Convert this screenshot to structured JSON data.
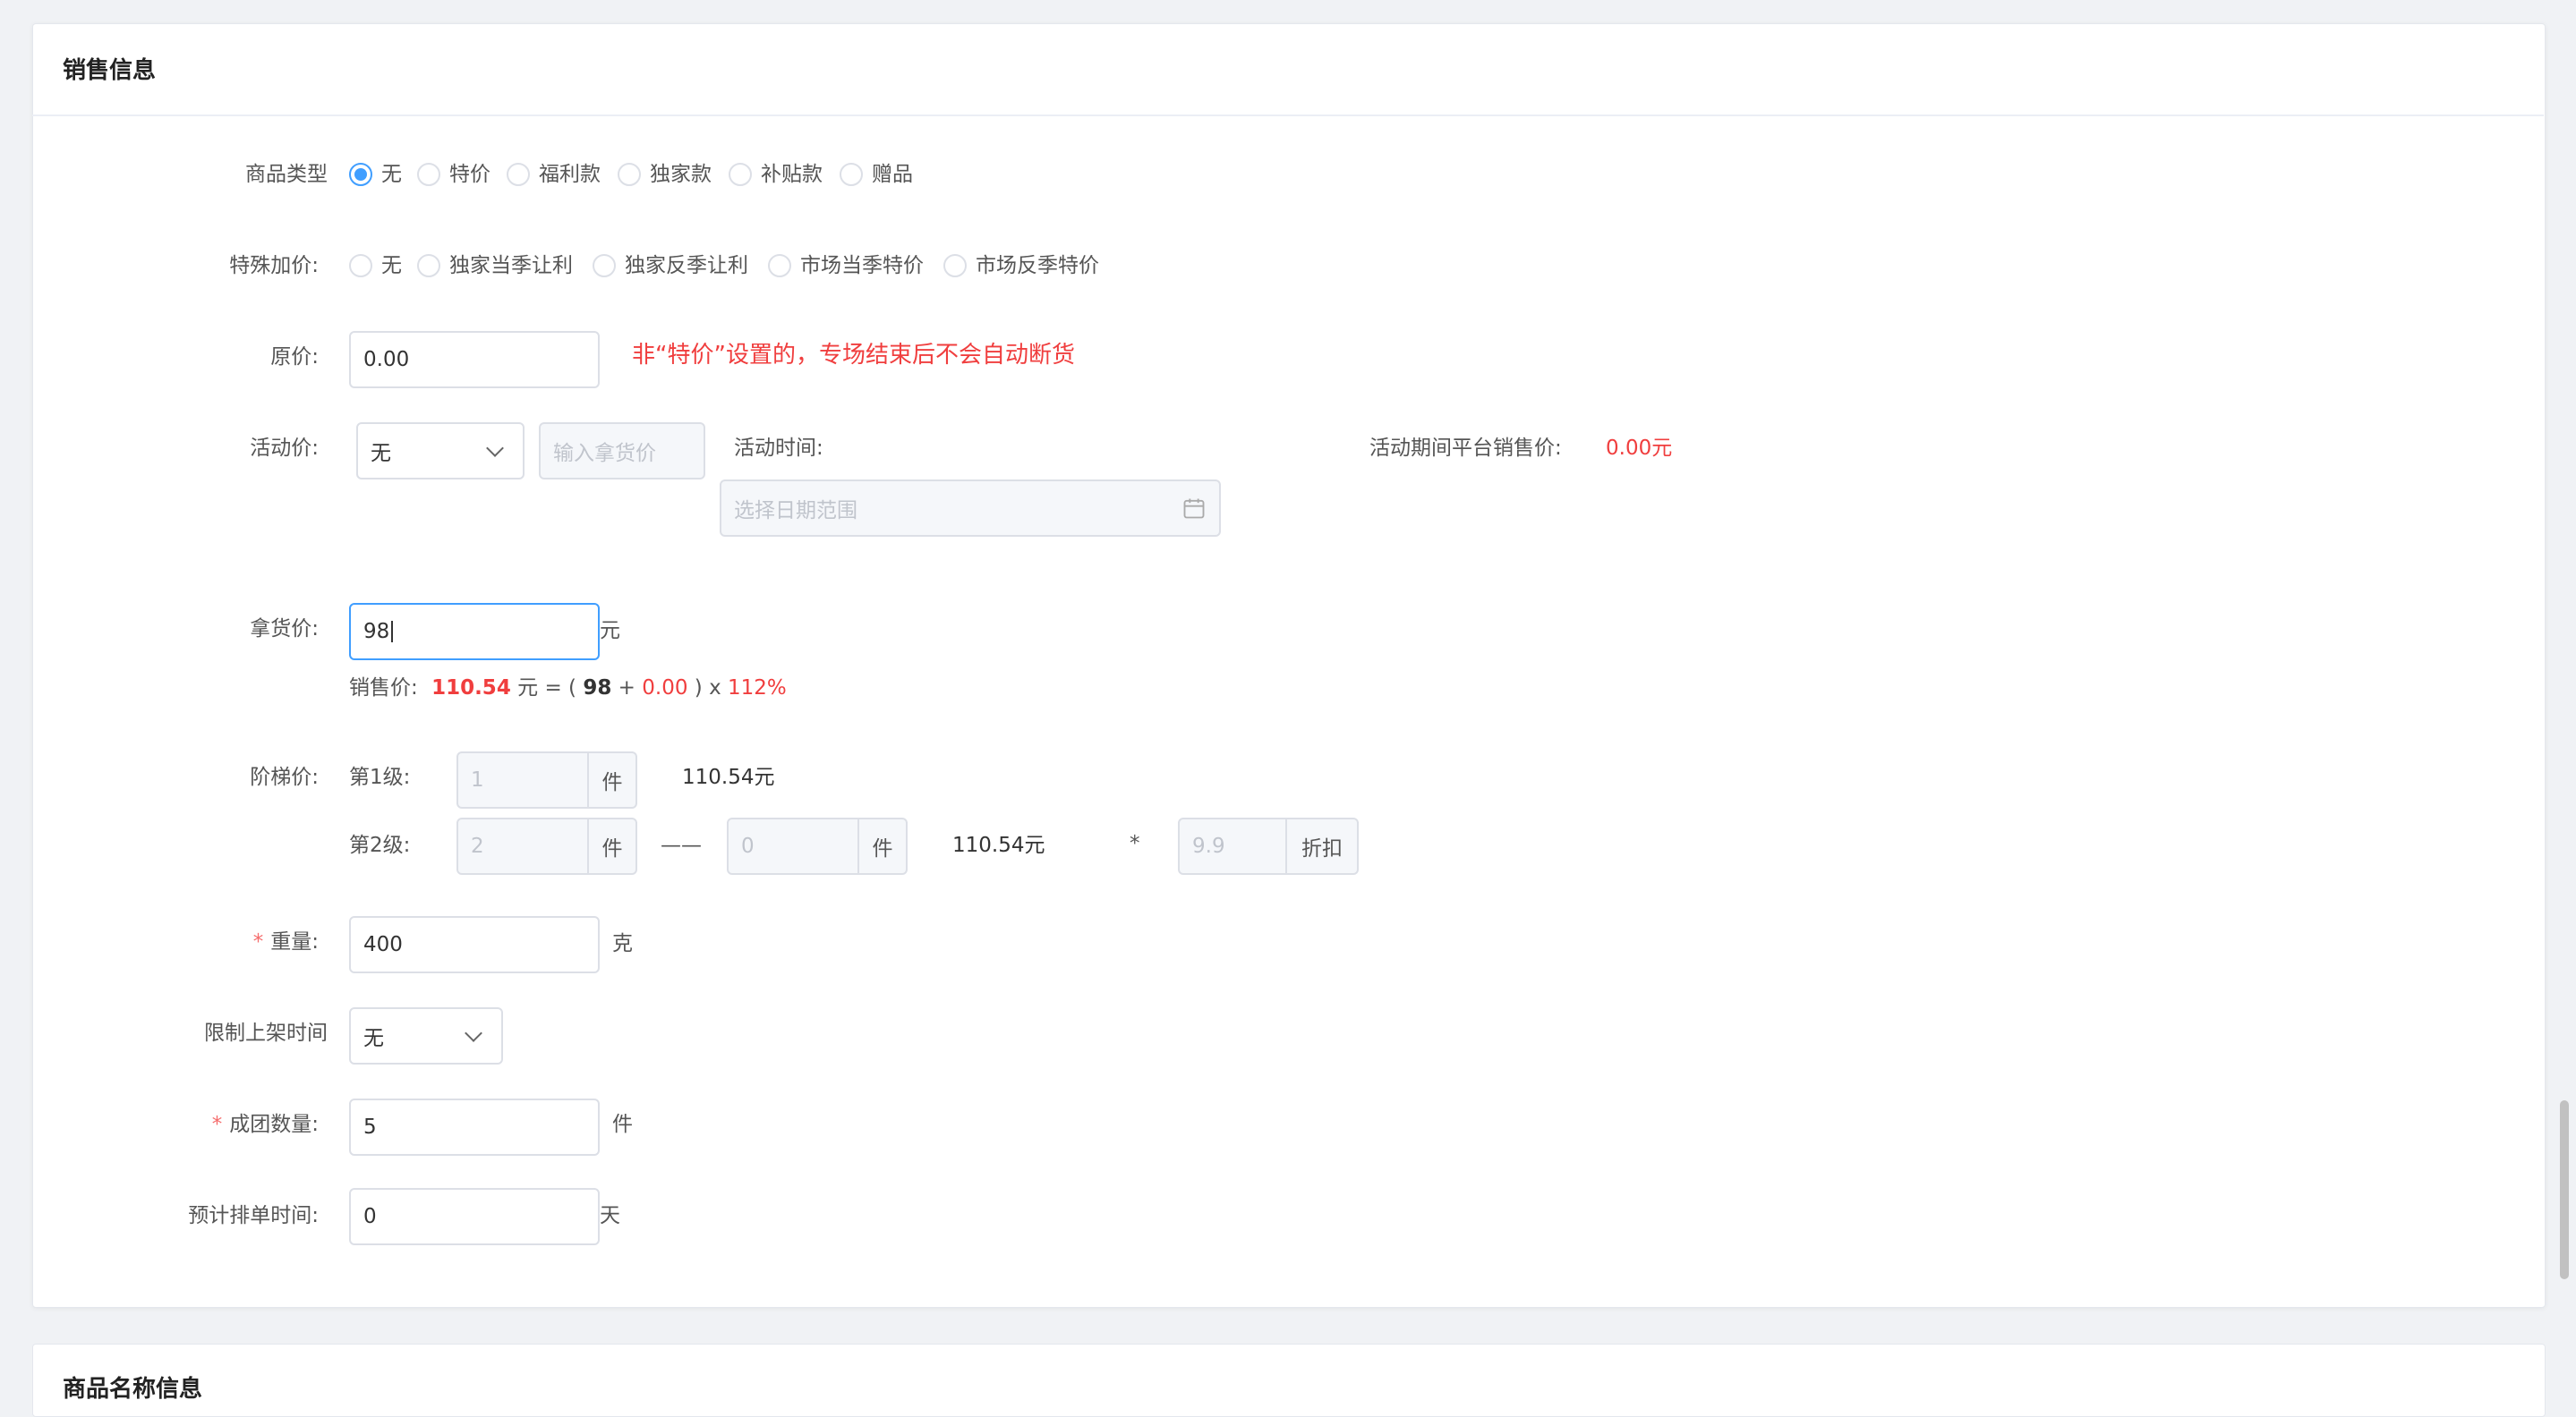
{
  "section": {
    "title": "销售信息",
    "next_title": "商品名称信息"
  },
  "product_type": {
    "label": "商品类型",
    "options": [
      "无",
      "特价",
      "福利款",
      "独家款",
      "补贴款",
      "赠品"
    ],
    "selected": 0
  },
  "special_markup": {
    "label": "特殊加价:",
    "options": [
      "无",
      "独家当季让利",
      "独家反季让利",
      "市场当季特价",
      "市场反季特价"
    ]
  },
  "original_price": {
    "label": "原价:",
    "value": "0.00",
    "notice": "非“特价”设置的，专场结束后不会自动断货"
  },
  "activity_price": {
    "label": "活动价:",
    "select_value": "无",
    "input_placeholder": "输入拿货价",
    "time_label": "活动时间:",
    "date_placeholder": "选择日期范围",
    "platform_price_label": "活动期间平台销售价:",
    "platform_price_value": "0.00元"
  },
  "purchase_price": {
    "label": "拿货价:",
    "value": "98",
    "unit": "元",
    "formula": {
      "label": "销售价:",
      "value": "110.54",
      "unit": "元",
      "eq_open": "= (",
      "base": "98",
      "plus": "+",
      "addon": "0.00",
      "close_mult": ") x",
      "percent": "112%"
    }
  },
  "tier_price": {
    "label": "阶梯价:",
    "tier1": {
      "label": "第1级:",
      "qty_placeholder": "1",
      "unit": "件",
      "price": "110.54元"
    },
    "tier2": {
      "label": "第2级:",
      "qty_placeholder": "2",
      "unit": "件",
      "dash": "——",
      "qty2_placeholder": "0",
      "unit2": "件",
      "price": "110.54元",
      "star": "*",
      "discount_placeholder": "9.9",
      "discount_unit": "折扣"
    }
  },
  "weight": {
    "required": "*",
    "label": "重量:",
    "value": "400",
    "unit": "克"
  },
  "listing_limit": {
    "label": "限制上架时间",
    "select_value": "无"
  },
  "group_qty": {
    "required": "*",
    "label": "成团数量:",
    "value": "5",
    "unit": "件"
  },
  "schedule": {
    "label": "预计排单时间:",
    "value": "0",
    "unit": "天"
  },
  "colors": {
    "primary": "#409eff",
    "danger": "#f03e3e",
    "border": "#dcdfe6"
  }
}
